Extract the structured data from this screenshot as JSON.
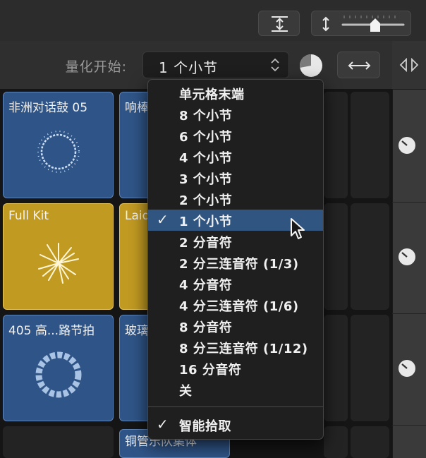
{
  "toolbar": {
    "quantize_label": "量化开始:",
    "quantize_value": "1 个小节"
  },
  "menu": {
    "items": [
      {
        "label": "单元格末端",
        "checked": false
      },
      {
        "label": "8 个小节",
        "checked": false
      },
      {
        "label": "6 个小节",
        "checked": false
      },
      {
        "label": "4 个小节",
        "checked": false
      },
      {
        "label": "3 个小节",
        "checked": false
      },
      {
        "label": "2 个小节",
        "checked": false
      },
      {
        "label": "1 个小节",
        "checked": true
      },
      {
        "label": "2 分音符",
        "checked": false
      },
      {
        "label": "2 分三连音符 (1/3)",
        "checked": false
      },
      {
        "label": "4 分音符",
        "checked": false
      },
      {
        "label": "4 分三连音符 (1/6)",
        "checked": false
      },
      {
        "label": "8 分音符",
        "checked": false
      },
      {
        "label": "8 分三连音符 (1/12)",
        "checked": false
      },
      {
        "label": "16 分音符",
        "checked": false
      },
      {
        "label": "关",
        "checked": false
      }
    ],
    "smart_pickup": {
      "label": "智能拾取",
      "checked": true
    },
    "check_glyph": "✓"
  },
  "cells": [
    {
      "title": "非洲对话鼓 05",
      "color": "blue"
    },
    {
      "title": "响棒",
      "color": "blue"
    },
    {
      "title": "Full Kit",
      "color": "gold"
    },
    {
      "title": "Laid",
      "color": "gold"
    },
    {
      "title": "405 高...路节拍",
      "color": "blue"
    },
    {
      "title": "玻璃",
      "color": "blue"
    },
    {
      "title": "铜管乐队集体",
      "color": "blue"
    }
  ],
  "colors": {
    "blue_cell": "#2f5588",
    "gold_cell": "#c19a22",
    "menu_highlight": "#2f5580"
  }
}
